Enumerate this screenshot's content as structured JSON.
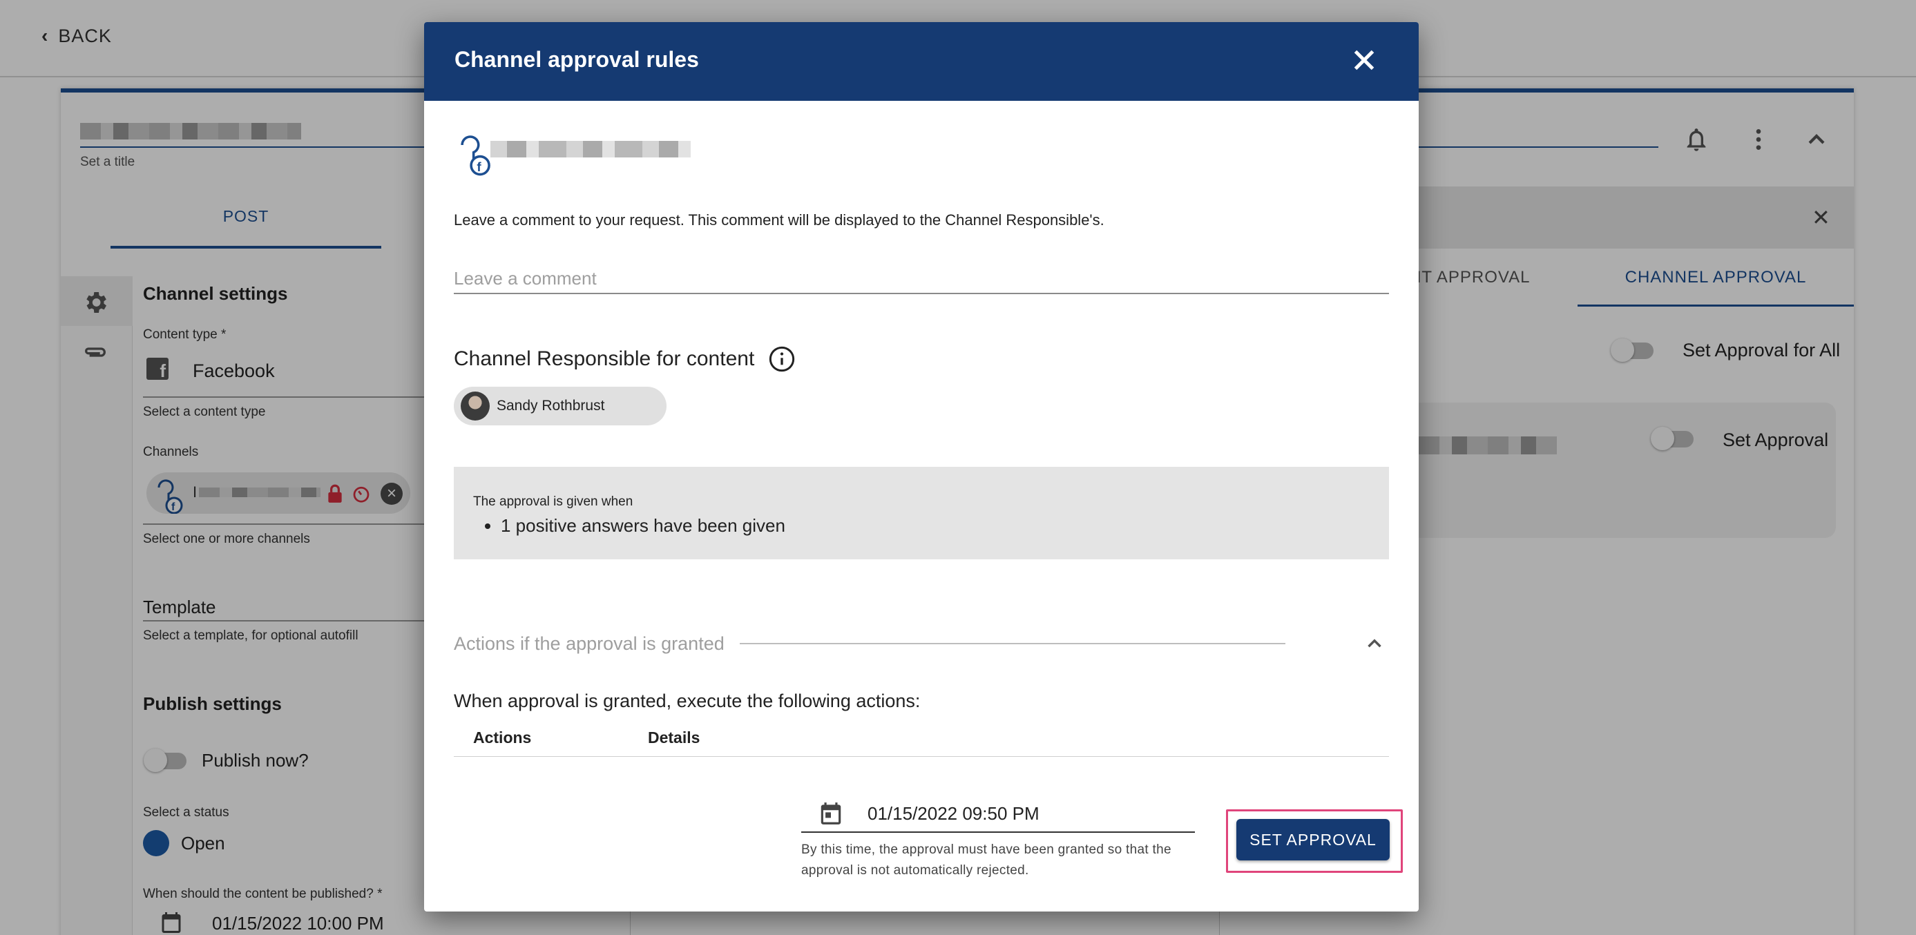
{
  "app": {
    "back_label": "BACK",
    "title_hint": "Set a title",
    "tab_post": "POST",
    "channel_settings_title": "Channel settings",
    "content_type_label": "Content type *",
    "content_type_value": "Facebook",
    "content_type_hint": "Select a content type",
    "channels_label": "Channels",
    "channels_chip_text": "I",
    "channels_hint": "Select one or more channels",
    "template_label": "Template",
    "template_hint": "Select a template, for optional autofill",
    "publish_settings_title": "Publish settings",
    "publish_now_label": "Publish now?",
    "status_label": "Select a status",
    "status_value": "Open",
    "publish_when_label": "When should the content be published? *",
    "publish_when_value": "01/15/2022 10:00 PM",
    "right_tab_content_approval": "NT APPROVAL",
    "right_tab_channel_approval": "CHANNEL APPROVAL",
    "set_approval_all_label": "Set Approval for All",
    "set_approval_label": "Set Approval"
  },
  "dialog": {
    "title": "Channel approval rules",
    "comment_instruction": "Leave a comment to your request. This comment will be displayed to the Channel Responsible's.",
    "comment_placeholder": "Leave a comment",
    "responsible_title": "Channel Responsible for content",
    "responsible_chip": "Sandy Rothbrust",
    "rule_label": "The approval is given when",
    "rule_items": [
      "1 positive answers have been given"
    ],
    "actions_section_label": "Actions if the approval is granted",
    "actions_intro": "When approval is granted, execute the following actions:",
    "table_columns": [
      "Actions",
      "Details"
    ],
    "deadline_value": "01/15/2022 09:50 PM",
    "deadline_hint": "By this time, the approval must have been granted so that the approval is not automatically rejected.",
    "set_approval_button": "SET APPROVAL"
  },
  "colors": {
    "header_blue": "#153a72",
    "accent_blue": "#1d4f91",
    "highlight_pink": "#e0457b",
    "status_dot": "#1d5aa6",
    "lock_red": "#d32f3f"
  }
}
